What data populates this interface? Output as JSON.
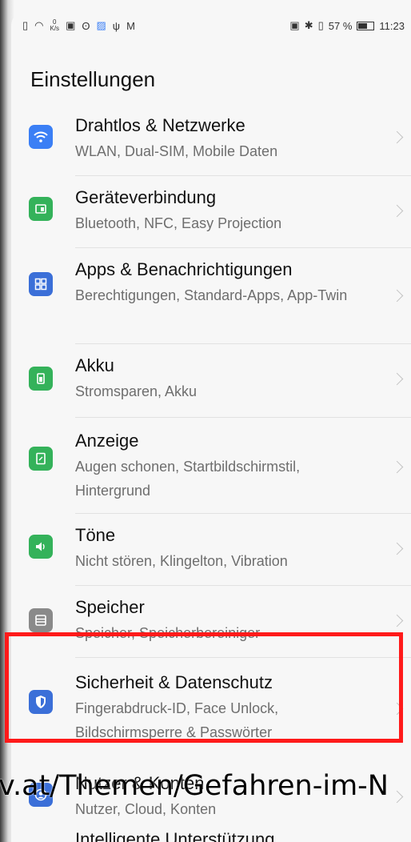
{
  "status_bar": {
    "left_icons": [
      "sim-card-icon",
      "wifi-icon",
      "data-speed-icon",
      "gallery-icon",
      "cat-icon",
      "image-icon",
      "usb-icon",
      "mail-icon"
    ],
    "data_speed": "0\nK/s",
    "nfc_label": "N",
    "battery_percent": "57 %",
    "time": "11:23"
  },
  "page": {
    "title": "Einstellungen"
  },
  "settings": [
    {
      "title": "Drahtlos & Netzwerke",
      "subtitle": "WLAN, Dual-SIM, Mobile Daten",
      "icon": "wifi-icon",
      "color": "#3b7ff5"
    },
    {
      "title": "Geräteverbindung",
      "subtitle": "Bluetooth, NFC, Easy Projection",
      "icon": "device-connection-icon",
      "color": "#34b25a"
    },
    {
      "title": "Apps & Benachrichtigungen",
      "subtitle": "Berechtigungen, Standard-Apps, App-Twin",
      "icon": "apps-grid-icon",
      "color": "#3b6fd8"
    },
    {
      "title": "Akku",
      "subtitle": "Stromsparen, Akku",
      "icon": "battery-icon",
      "color": "#34b25a"
    },
    {
      "title": "Anzeige",
      "subtitle": "Augen schonen, Startbildschirmstil, Hintergrund",
      "icon": "display-icon",
      "color": "#34b25a"
    },
    {
      "title": "Töne",
      "subtitle": "Nicht stören, Klingelton, Vibration",
      "icon": "sound-icon",
      "color": "#34b25a"
    },
    {
      "title": "Speicher",
      "subtitle": "Speicher, Speicherbereiniger",
      "icon": "storage-icon",
      "color": "#8a8a8a"
    },
    {
      "title": "Sicherheit & Datenschutz",
      "subtitle": "Fingerabdruck-ID, Face Unlock, Bildschirmsperre & Passwörter",
      "icon": "shield-icon",
      "color": "#3b6fd8"
    },
    {
      "title": "Nutzer & Konten",
      "subtitle": "Nutzer, Cloud, Konten",
      "icon": "user-icon",
      "color": "#3b6fd8"
    },
    {
      "title": "Intelligente Unterstützung",
      "subtitle": "",
      "icon": "assist-icon",
      "color": "#3b6fd8"
    }
  ],
  "overlay": {
    "watermark": "v.at/Themen/Gefahren-im-N"
  },
  "colors": {
    "highlight": "#ff1a1a",
    "background": "#f7f7f7"
  }
}
